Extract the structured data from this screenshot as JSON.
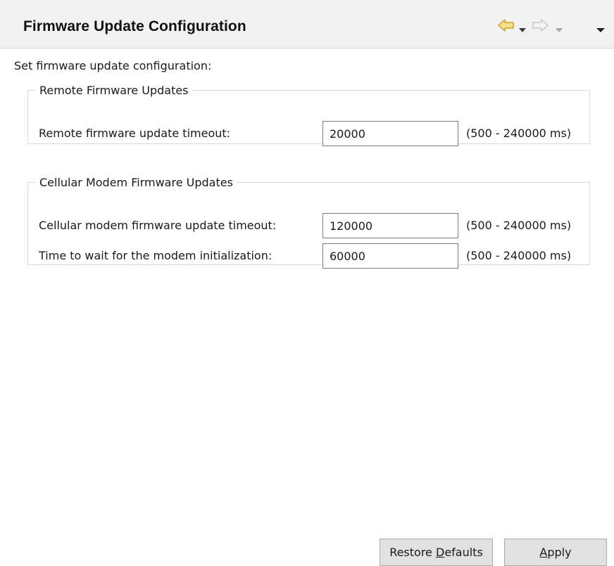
{
  "header": {
    "title": "Firmware Update Configuration",
    "icons": {
      "back": "back-arrow-icon",
      "back_menu": "chevron-down-icon",
      "forward": "forward-arrow-icon",
      "forward_menu": "chevron-down-icon",
      "view_menu": "view-menu-icon"
    },
    "colors": {
      "back_arrow_fill": "#f7e08a",
      "back_arrow_stroke": "#c9a227",
      "forward_arrow_fill": "#f4f4f4",
      "forward_arrow_stroke": "#c6c6c6"
    }
  },
  "description": "Set firmware update configuration:",
  "remote_group": {
    "legend": "Remote Firmware Updates",
    "timeout": {
      "label": "Remote firmware update timeout:",
      "value": "20000",
      "range": "(500 - 240000 ms)"
    }
  },
  "cellular_group": {
    "legend": "Cellular Modem Firmware Updates",
    "timeout": {
      "label": "Cellular modem firmware update timeout:",
      "value": "120000",
      "range": "(500 - 240000 ms)"
    },
    "init_wait": {
      "label": "Time to wait for the modem initialization:",
      "value": "60000",
      "range": "(500 - 240000 ms)"
    }
  },
  "buttons": {
    "restore_prefix": "Restore ",
    "restore_mnemonic": "D",
    "restore_suffix": "efaults",
    "apply_mnemonic": "A",
    "apply_suffix": "pply"
  }
}
